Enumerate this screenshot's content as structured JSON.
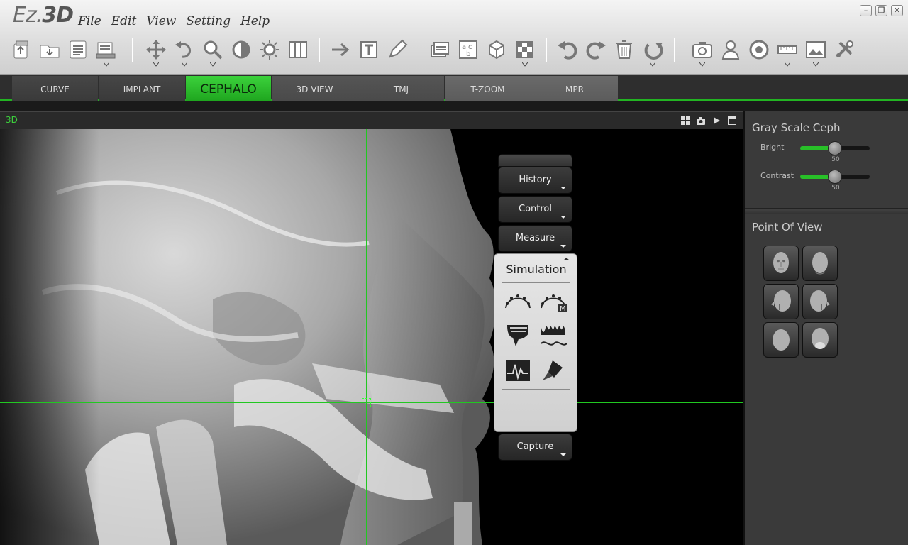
{
  "app": {
    "logo_prefix": "Ez.",
    "logo_bold": "3D"
  },
  "menu": [
    "File",
    "Edit",
    "View",
    "Setting",
    "Help"
  ],
  "window_controls": [
    "minimize",
    "restore",
    "close"
  ],
  "toolbar": {
    "icons": [
      "export-icon",
      "open-folder-icon",
      "report-icon",
      "save-dropdown-icon",
      "move-icon",
      "undo-rotate-icon",
      "zoom-icon",
      "contrast-icon",
      "brightness-icon",
      "layout-columns-icon",
      "arrow-icon",
      "text-icon",
      "pen-icon",
      "layers-icon",
      "spell-icon",
      "cube-icon",
      "checker-icon",
      "undo-icon",
      "redo-icon",
      "delete-icon",
      "reset-icon",
      "camera-icon",
      "patient-icon",
      "target-icon",
      "ruler-icon",
      "image-icon",
      "tools-icon"
    ]
  },
  "tabs": [
    {
      "label": "CURVE"
    },
    {
      "label": "IMPLANT"
    },
    {
      "label": "CEPHALO"
    },
    {
      "label": "3D VIEW"
    },
    {
      "label": "TMJ"
    },
    {
      "label": "T-ZOOM"
    },
    {
      "label": "MPR"
    }
  ],
  "viewport": {
    "title": "3D"
  },
  "float_panel": {
    "buttons": {
      "history": "History",
      "control": "Control",
      "measure": "Measure",
      "capture": "Capture"
    },
    "simulation": {
      "title": "Simulation",
      "icons": [
        "arch-icon",
        "arch-m-icon",
        "profile-teeth-icon",
        "teeth-row-icon",
        "waveform-icon",
        "brush-icon"
      ]
    }
  },
  "right_panel": {
    "gray_scale": {
      "title": "Gray Scale Ceph",
      "bright_label": "Bright",
      "bright_value": "50",
      "contrast_label": "Contrast",
      "contrast_value": "50"
    },
    "point_of_view": {
      "title": "Point Of View",
      "views": [
        "front-view-icon",
        "back-view-icon",
        "left-view-icon",
        "right-view-icon",
        "top-view-icon",
        "bottom-view-icon"
      ]
    }
  },
  "colors": {
    "accent": "#22b422",
    "crosshair": "#21c821"
  }
}
